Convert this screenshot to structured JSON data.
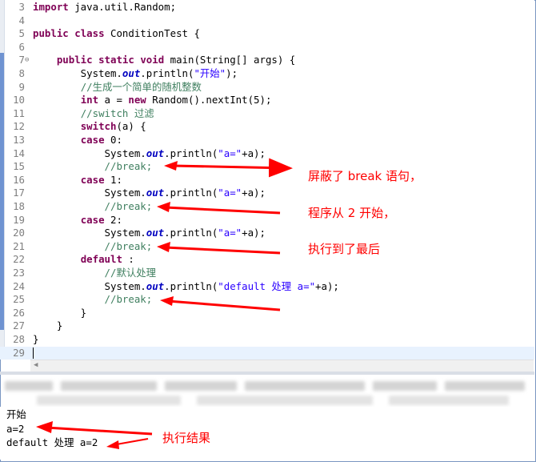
{
  "editor": {
    "lines": [
      {
        "num": "3",
        "tokens": [
          {
            "t": "import",
            "c": "kw"
          },
          {
            "t": " java.util.Random;"
          }
        ]
      },
      {
        "num": "4",
        "tokens": []
      },
      {
        "num": "5",
        "tokens": [
          {
            "t": "public",
            "c": "kw"
          },
          {
            "t": " "
          },
          {
            "t": "class",
            "c": "kw"
          },
          {
            "t": " ConditionTest {"
          }
        ]
      },
      {
        "num": "6",
        "tokens": []
      },
      {
        "num": "7",
        "fold": "⊖",
        "tokens": [
          {
            "t": "    "
          },
          {
            "t": "public",
            "c": "kw"
          },
          {
            "t": " "
          },
          {
            "t": "static",
            "c": "kw"
          },
          {
            "t": " "
          },
          {
            "t": "void",
            "c": "kw"
          },
          {
            "t": " main(String[] args) {"
          }
        ]
      },
      {
        "num": "8",
        "tokens": [
          {
            "t": "        System."
          },
          {
            "t": "out",
            "c": "fi"
          },
          {
            "t": ".println("
          },
          {
            "t": "\"开始\"",
            "c": "st"
          },
          {
            "t": ");"
          }
        ]
      },
      {
        "num": "9",
        "tokens": [
          {
            "t": "        "
          },
          {
            "t": "//生成一个简单的随机整数",
            "c": "cm"
          }
        ]
      },
      {
        "num": "10",
        "tokens": [
          {
            "t": "        "
          },
          {
            "t": "int",
            "c": "kw"
          },
          {
            "t": " a = "
          },
          {
            "t": "new",
            "c": "kw"
          },
          {
            "t": " Random().nextInt(5);"
          }
        ]
      },
      {
        "num": "11",
        "tokens": [
          {
            "t": "        "
          },
          {
            "t": "//switch 过滤",
            "c": "cm"
          }
        ]
      },
      {
        "num": "12",
        "tokens": [
          {
            "t": "        "
          },
          {
            "t": "switch",
            "c": "kw"
          },
          {
            "t": "(a) {"
          }
        ]
      },
      {
        "num": "13",
        "tokens": [
          {
            "t": "        "
          },
          {
            "t": "case",
            "c": "kw"
          },
          {
            "t": " 0:"
          }
        ]
      },
      {
        "num": "14",
        "tokens": [
          {
            "t": "            System."
          },
          {
            "t": "out",
            "c": "fi"
          },
          {
            "t": ".println("
          },
          {
            "t": "\"a=\"",
            "c": "st"
          },
          {
            "t": "+a);"
          }
        ]
      },
      {
        "num": "15",
        "tokens": [
          {
            "t": "            "
          },
          {
            "t": "//break;",
            "c": "cm"
          }
        ]
      },
      {
        "num": "16",
        "tokens": [
          {
            "t": "        "
          },
          {
            "t": "case",
            "c": "kw"
          },
          {
            "t": " 1:"
          }
        ]
      },
      {
        "num": "17",
        "tokens": [
          {
            "t": "            System."
          },
          {
            "t": "out",
            "c": "fi"
          },
          {
            "t": ".println("
          },
          {
            "t": "\"a=\"",
            "c": "st"
          },
          {
            "t": "+a);"
          }
        ]
      },
      {
        "num": "18",
        "tokens": [
          {
            "t": "            "
          },
          {
            "t": "//break;",
            "c": "cm"
          }
        ]
      },
      {
        "num": "19",
        "tokens": [
          {
            "t": "        "
          },
          {
            "t": "case",
            "c": "kw"
          },
          {
            "t": " 2:"
          }
        ]
      },
      {
        "num": "20",
        "tokens": [
          {
            "t": "            System."
          },
          {
            "t": "out",
            "c": "fi"
          },
          {
            "t": ".println("
          },
          {
            "t": "\"a=\"",
            "c": "st"
          },
          {
            "t": "+a);"
          }
        ]
      },
      {
        "num": "21",
        "tokens": [
          {
            "t": "            "
          },
          {
            "t": "//break;",
            "c": "cm"
          }
        ]
      },
      {
        "num": "22",
        "tokens": [
          {
            "t": "        "
          },
          {
            "t": "default",
            "c": "kw"
          },
          {
            "t": " :"
          }
        ]
      },
      {
        "num": "23",
        "tokens": [
          {
            "t": "            "
          },
          {
            "t": "//默认处理",
            "c": "cm"
          }
        ]
      },
      {
        "num": "24",
        "tokens": [
          {
            "t": "            System."
          },
          {
            "t": "out",
            "c": "fi"
          },
          {
            "t": ".println("
          },
          {
            "t": "\"default 处理 a=\"",
            "c": "st"
          },
          {
            "t": "+a);"
          }
        ]
      },
      {
        "num": "25",
        "tokens": [
          {
            "t": "            "
          },
          {
            "t": "//break;",
            "c": "cm"
          }
        ]
      },
      {
        "num": "26",
        "tokens": [
          {
            "t": "        }"
          }
        ]
      },
      {
        "num": "27",
        "tokens": [
          {
            "t": "    }"
          }
        ]
      },
      {
        "num": "28",
        "tokens": [
          {
            "t": "}"
          }
        ]
      },
      {
        "num": "29",
        "current": true,
        "tokens": []
      }
    ]
  },
  "annotations": {
    "line1": "屏蔽了 break 语句，",
    "line2": "程序从 2 开始，",
    "line3": "执行到了最后",
    "result": "执行结果"
  },
  "console": {
    "lines": [
      "开始",
      "a=2",
      "default 处理 a=2"
    ]
  },
  "colors": {
    "keyword": "#7f0055",
    "string": "#2a00ff",
    "comment": "#3f7f5f",
    "field": "#0000c0",
    "annotation": "#ff0000"
  }
}
